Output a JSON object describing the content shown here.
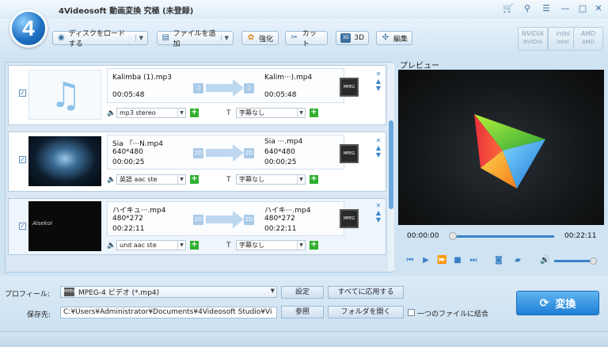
{
  "window": {
    "title": "4Videosoft 動画変換 究極 (未登録)",
    "logo_text": "4",
    "controls": {
      "cart": "🛒",
      "key": "⚲",
      "menu": "☰",
      "minimize": "—",
      "maximize": "□",
      "close": "✕"
    }
  },
  "toolbar": {
    "load_disc": "ディスクをロードする",
    "add_file": "ファイルを追加",
    "enhance": "強化",
    "cut": "カット",
    "three_d": "3D",
    "three_d_badge": "3D",
    "edit": "編集",
    "accel": [
      {
        "top": "NVIDIA",
        "bottom": "NVIDIA"
      },
      {
        "top": "intel",
        "bottom": "Intel"
      },
      {
        "top": "AMD",
        "bottom": "AMD"
      }
    ]
  },
  "files": [
    {
      "src_name": "Kalimba (1).mp3",
      "src_duration": "00:05:48",
      "dst_name": "Kalim···).mp4",
      "dst_duration": "00:05:48",
      "audio": "mp3 stereo",
      "subtitle": "字幕なし",
      "checked": true
    },
    {
      "src_name": "Sia 『···N.mp4",
      "src_res": "640*480",
      "src_duration": "00:00:25",
      "dst_name": "Sia ···.mp4",
      "dst_res": "640*480",
      "dst_duration": "00:00:25",
      "audio": "英語 aac ste",
      "subtitle": "字幕なし",
      "checked": true
    },
    {
      "src_name": "ハイキュ···.mp4",
      "src_res": "480*272",
      "src_duration": "00:22:11",
      "dst_name": "ハイキ···.mp4",
      "dst_res": "480*272",
      "dst_duration": "00:22:11",
      "audio": "und aac ste",
      "subtitle": "字幕なし",
      "checked": true,
      "thumb_caption": "Aisekoi"
    }
  ],
  "badges": {
    "two_d": "2D",
    "film": "MPEG"
  },
  "preview": {
    "label": "プレビュー",
    "current_time": "00:00:00",
    "total_time": "00:22:11",
    "seek_fraction": 0,
    "volume_fraction": 0.9
  },
  "profile": {
    "label": "プロフィール:",
    "value": "MPEG-4 ビデオ (*.mp4)",
    "settings_btn": "設定",
    "apply_all_btn": "すべてに応用する"
  },
  "output": {
    "label": "保存先:",
    "path": "C:¥Users¥Administrator¥Documents¥4Videosoft Studio¥Vi",
    "browse_btn": "参照",
    "open_folder_btn": "フォルダを開く",
    "merge_label": "一つのファイルに結合",
    "merge_checked": false
  },
  "convert_btn": "変換",
  "colors": {
    "accent": "#1f7fd6",
    "seek": "#3b82c6",
    "add_plus": "#2fb02f"
  }
}
